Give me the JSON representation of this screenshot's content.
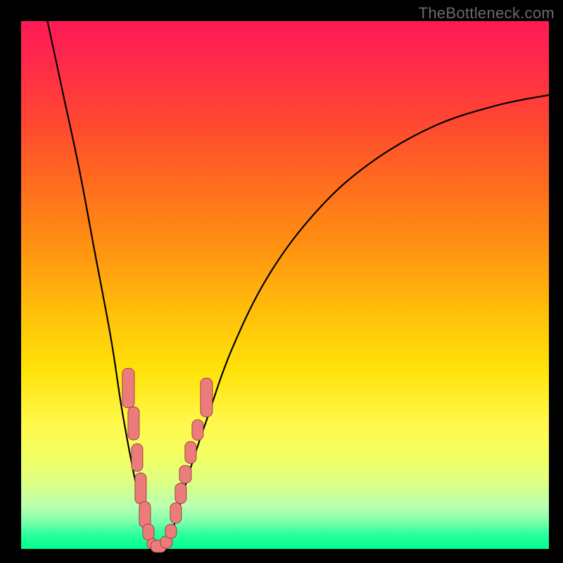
{
  "watermark": "TheBottleneck.com",
  "colors": {
    "curve": "#000000",
    "marker_fill": "#ec7c7c",
    "marker_stroke": "#9c4040",
    "frame": "#000000"
  },
  "chart_data": {
    "type": "line",
    "title": "",
    "xlabel": "",
    "ylabel": "",
    "xlim": [
      0,
      100
    ],
    "ylim": [
      0,
      100
    ],
    "series": [
      {
        "name": "left-curve",
        "x": [
          5,
          8,
          11,
          14,
          17,
          19,
          21,
          22.5,
          24,
          24.8
        ],
        "y": [
          100,
          86,
          72,
          56,
          40,
          27,
          16,
          9,
          3,
          0
        ]
      },
      {
        "name": "right-curve",
        "x": [
          27.2,
          28.5,
          30,
          32,
          35,
          40,
          47,
          56,
          66,
          78,
          90,
          100
        ],
        "y": [
          0,
          3,
          8,
          15,
          24,
          38,
          52,
          64,
          73,
          80,
          84,
          86
        ]
      }
    ],
    "markers": [
      {
        "x": 20.3,
        "y": 30.5,
        "w": 2.3,
        "h": 7.5
      },
      {
        "x": 21.3,
        "y": 23.8,
        "w": 2.3,
        "h": 6.5
      },
      {
        "x": 22.0,
        "y": 17.3,
        "w": 2.3,
        "h": 5.3
      },
      {
        "x": 22.6,
        "y": 11.5,
        "w": 2.3,
        "h": 6.0
      },
      {
        "x": 23.4,
        "y": 6.5,
        "w": 2.3,
        "h": 5.0
      },
      {
        "x": 24.1,
        "y": 3.2,
        "w": 2.3,
        "h": 3.2
      },
      {
        "x": 24.9,
        "y": 1.0,
        "w": 2.3,
        "h": 2.2
      },
      {
        "x": 26.0,
        "y": 0.5,
        "w": 3.0,
        "h": 2.3
      },
      {
        "x": 27.5,
        "y": 1.3,
        "w": 2.3,
        "h": 2.3
      },
      {
        "x": 28.4,
        "y": 3.4,
        "w": 2.3,
        "h": 2.8
      },
      {
        "x": 29.3,
        "y": 6.8,
        "w": 2.3,
        "h": 4.0
      },
      {
        "x": 30.2,
        "y": 10.5,
        "w": 2.3,
        "h": 4.0
      },
      {
        "x": 31.1,
        "y": 14.2,
        "w": 2.3,
        "h": 3.5
      },
      {
        "x": 32.1,
        "y": 18.3,
        "w": 2.3,
        "h": 4.3
      },
      {
        "x": 33.4,
        "y": 22.5,
        "w": 2.3,
        "h": 4.0
      },
      {
        "x": 35.1,
        "y": 28.7,
        "w": 2.3,
        "h": 7.5
      }
    ]
  }
}
